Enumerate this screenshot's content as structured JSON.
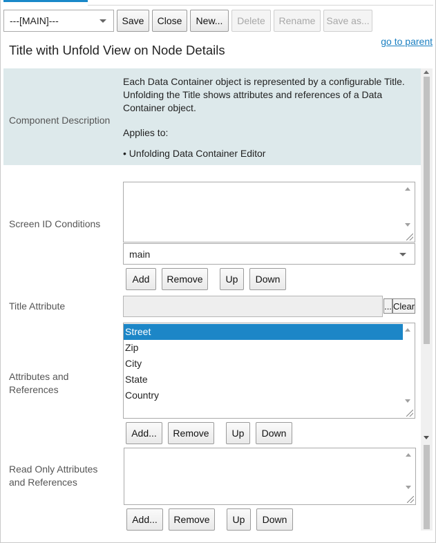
{
  "toolbar": {
    "config_select": "---[MAIN]---",
    "save": "Save",
    "close": "Close",
    "new": "New...",
    "delete": "Delete",
    "rename": "Rename",
    "save_as": "Save as..."
  },
  "header": {
    "title": "Title with Unfold View on Node Details",
    "go_to_parent": "go to parent"
  },
  "component_description": {
    "label": "Component Description",
    "text": "Each Data Container object is represented by a configurable Title. Unfolding the Title shows attributes and references of a Data Container object.",
    "applies_to_label": "Applies to:",
    "applies_to_item": "• Unfolding Data Container Editor"
  },
  "screen_id": {
    "label": "Screen ID Conditions",
    "select_value": "main",
    "add": "Add",
    "remove": "Remove",
    "up": "Up",
    "down": "Down"
  },
  "title_attribute": {
    "label": "Title Attribute",
    "browse": "...",
    "clear": "Clear"
  },
  "attributes": {
    "label": "Attributes and References",
    "items": [
      "Street",
      "Zip",
      "City",
      "State",
      "Country"
    ],
    "selected_index": 0,
    "add": "Add...",
    "remove": "Remove",
    "up": "Up",
    "down": "Down"
  },
  "readonly": {
    "label": "Read Only Attributes and References",
    "add": "Add...",
    "remove": "Remove",
    "up": "Up",
    "down": "Down"
  },
  "colors": {
    "accent": "#1c86c7",
    "link": "#1a7fc1",
    "description_bg": "#dde9eb"
  }
}
